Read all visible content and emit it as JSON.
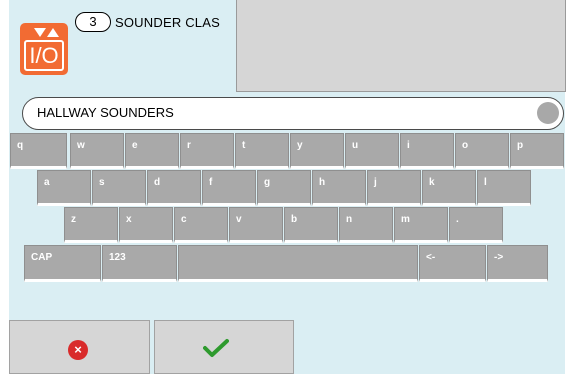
{
  "header": {
    "badge_number": "3",
    "title": "SOUNDER CLAS",
    "icon_text": "I/O"
  },
  "input": {
    "value": "HALLWAY SOUNDERS"
  },
  "keyboard": {
    "row1": [
      "q",
      "w",
      "e",
      "r",
      "t",
      "y",
      "u",
      "i",
      "o",
      "p"
    ],
    "row2": [
      "a",
      "s",
      "d",
      "f",
      "g",
      "h",
      "j",
      "k",
      "l"
    ],
    "row3": [
      "z",
      "x",
      "c",
      "v",
      "b",
      "n",
      "m",
      "."
    ],
    "cap": "CAP",
    "num": "123",
    "space": "",
    "left": "<-",
    "right": "->"
  },
  "colors": {
    "background": "#daeef3",
    "icon_orange": "#f26b33",
    "cancel_red": "#d92b2b",
    "ok_green": "#2e9a2e"
  }
}
